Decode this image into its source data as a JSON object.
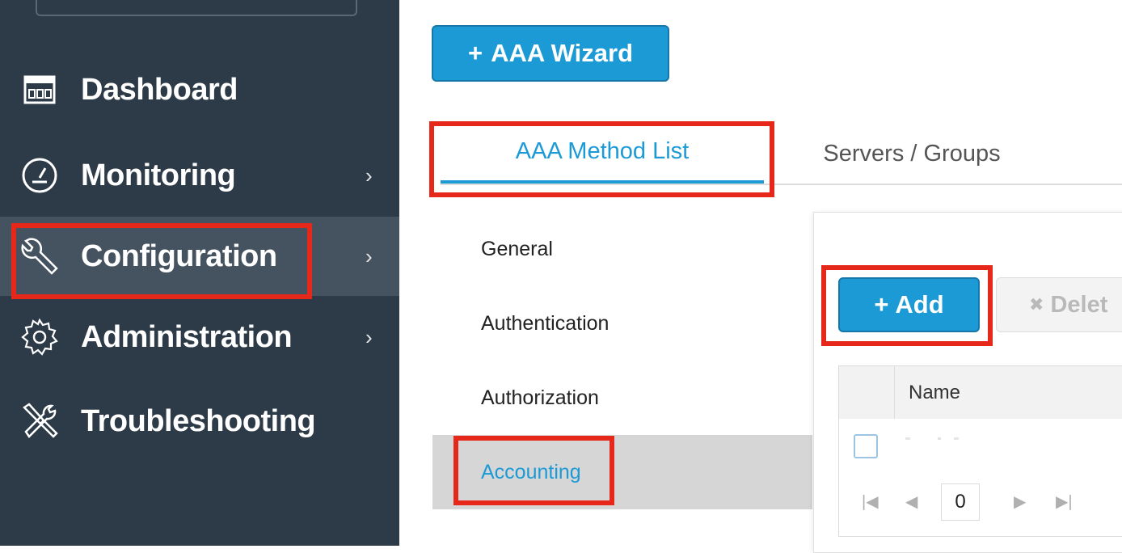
{
  "sidebar": {
    "items": [
      {
        "label": "Dashboard",
        "icon": "dashboard-icon",
        "chevron": ""
      },
      {
        "label": "Monitoring",
        "icon": "gauge-icon",
        "chevron": "›"
      },
      {
        "label": "Configuration",
        "icon": "wrench-icon",
        "chevron": "›"
      },
      {
        "label": "Administration",
        "icon": "gear-icon",
        "chevron": "›"
      },
      {
        "label": "Troubleshooting",
        "icon": "tools-icon",
        "chevron": ""
      }
    ]
  },
  "toolbar": {
    "wizard_label": "AAA Wizard",
    "plus": "+"
  },
  "tabs": [
    {
      "label": "AAA Method List"
    },
    {
      "label": "Servers / Groups"
    }
  ],
  "subnav": [
    {
      "label": "General"
    },
    {
      "label": "Authentication"
    },
    {
      "label": "Authorization"
    },
    {
      "label": "Accounting"
    }
  ],
  "panel": {
    "add_label": "Add",
    "plus": "+",
    "delete_label": "Delet",
    "delete_icon": "✖",
    "column_name": "Name",
    "pager": {
      "first": "|◀",
      "prev": "◀",
      "page": "0",
      "next": "▶",
      "last": "▶|"
    }
  },
  "colors": {
    "accent": "#1b9ad6",
    "sidebar": "#2d3a47",
    "highlight": "#e5281a"
  }
}
